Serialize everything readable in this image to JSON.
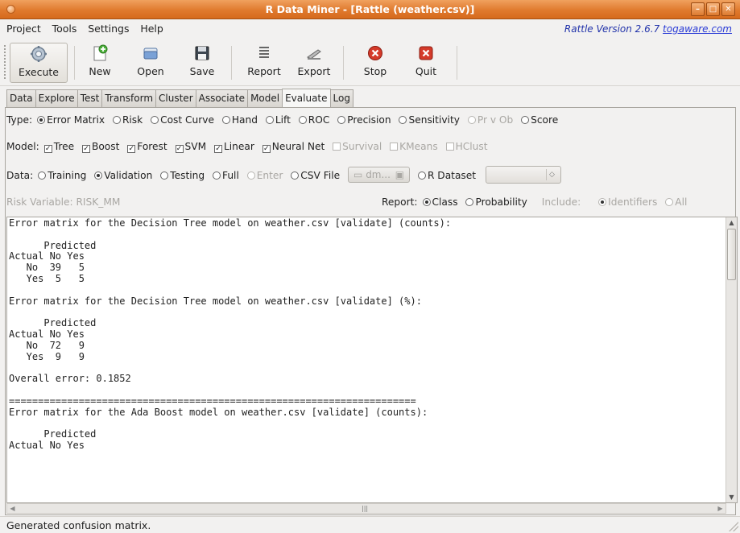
{
  "window": {
    "title": "R Data Miner - [Rattle (weather.csv)]"
  },
  "menu": {
    "items": [
      "Project",
      "Tools",
      "Settings",
      "Help"
    ]
  },
  "version": {
    "text": "Rattle Version 2.6.7",
    "link": "togaware.com"
  },
  "toolbar": {
    "buttons": [
      {
        "label": "Execute",
        "icon": "gear-icon"
      },
      {
        "label": "New",
        "icon": "new-document-icon"
      },
      {
        "label": "Open",
        "icon": "folder-open-icon"
      },
      {
        "label": "Save",
        "icon": "floppy-disk-icon"
      },
      {
        "label": "Report",
        "icon": "report-icon"
      },
      {
        "label": "Export",
        "icon": "export-icon"
      },
      {
        "label": "Stop",
        "icon": "stop-icon"
      },
      {
        "label": "Quit",
        "icon": "quit-icon"
      }
    ]
  },
  "tabs": [
    "Data",
    "Explore",
    "Test",
    "Transform",
    "Cluster",
    "Associate",
    "Model",
    "Evaluate",
    "Log"
  ],
  "active_tab": "Evaluate",
  "type_row": {
    "label": "Type:",
    "options": [
      "Error Matrix",
      "Risk",
      "Cost Curve",
      "Hand",
      "Lift",
      "ROC",
      "Precision",
      "Sensitivity",
      "Pr v Ob",
      "Score"
    ],
    "selected": "Error Matrix"
  },
  "model_row": {
    "label": "Model:",
    "checked": [
      "Tree",
      "Boost",
      "Forest",
      "SVM",
      "Linear",
      "Neural Net"
    ],
    "unchecked_disabled": [
      "Survival",
      "KMeans",
      "HClust"
    ]
  },
  "data_row": {
    "label": "Data:",
    "options": [
      "Training",
      "Validation",
      "Testing",
      "Full",
      "Enter",
      "CSV File"
    ],
    "selected": "Validation",
    "file_button": "dm...",
    "r_dataset": "R Dataset"
  },
  "risk_row": {
    "risk_variable": "Risk Variable: RISK_MM",
    "report_label": "Report:",
    "report_options": [
      "Class",
      "Probability"
    ],
    "report_selected": "Class",
    "include_label": "Include:",
    "include_options": [
      "Identifiers",
      "All"
    ]
  },
  "output": {
    "text": "Error matrix for the Decision Tree model on weather.csv [validate] (counts):\n\n      Predicted\nActual No Yes\n   No  39   5\n   Yes  5   5\n\nError matrix for the Decision Tree model on weather.csv [validate] (%):\n\n      Predicted\nActual No Yes\n   No  72   9\n   Yes  9   9\n\nOverall error: 0.1852\n\n======================================================================\nError matrix for the Ada Boost model on weather.csv [validate] (counts):\n\n      Predicted\nActual No Yes"
  },
  "status": {
    "text": "Generated confusion matrix."
  }
}
